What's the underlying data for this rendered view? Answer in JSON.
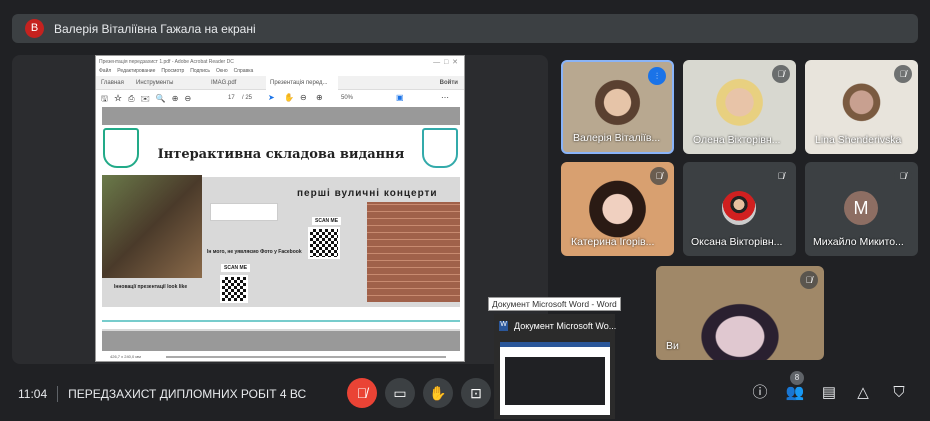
{
  "banner": {
    "avatar_letter": "В",
    "text": "Валерія Віталіївна Гажала на екрані",
    "avatar_color": "#c5221f"
  },
  "pdf": {
    "window_title": "Презентація передзахист 1.pdf - Adobe Acrobat Reader DC",
    "menu": [
      "Файл",
      "Редактирование",
      "Просмотр",
      "Подпись",
      "Окно",
      "Справка"
    ],
    "tabs": [
      "Главная",
      "Инструменты",
      "IMAG.pdf",
      "Презентація перед..."
    ],
    "signin": "Войти",
    "page_current": "17",
    "page_total": "/ 25",
    "zoom": "50%",
    "status": "426,7 x 240,0 мм",
    "slide": {
      "title": "Інтерактивна складова видання",
      "subtitle": "перші вуличні концерти",
      "caption_left": "Інновації презентації look like",
      "caption_mid": "Ін мого, не уявляємо Фото у Facebook",
      "scan1": "SCAN ME",
      "scan2": "SCAN ME"
    }
  },
  "participants": [
    {
      "name": "Валерія Віталіїв...",
      "speaking": true
    },
    {
      "name": "Олена Вікторівн...",
      "muted": true
    },
    {
      "name": "Lina Shenderivska",
      "muted": true
    },
    {
      "name": "Катерина Ігорів...",
      "muted": true
    },
    {
      "name": "Оксана Вікторівн...",
      "muted": true
    },
    {
      "name": "Михайло Микито...",
      "muted": true,
      "avatar_letter": "М"
    },
    {
      "name": "Ви",
      "muted": true
    }
  ],
  "taskbar_preview": {
    "tooltip": "Документ Microsoft Word - Word",
    "title": "Документ Microsoft Wo..."
  },
  "bottom": {
    "time": "11:04",
    "meeting_title": "ПЕРЕДЗАХИСТ ДИПЛОМНИХ РОБІТ 4 ВС",
    "participant_count": "8"
  },
  "colors": {
    "accent": "#8ab4f8",
    "danger": "#ea4335",
    "background": "#202124"
  }
}
